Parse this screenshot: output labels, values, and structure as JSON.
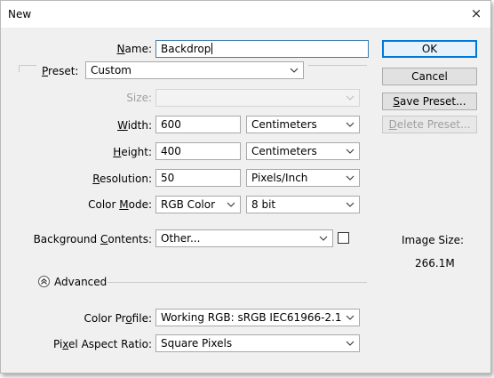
{
  "window": {
    "title": "New",
    "close_glyph": "×"
  },
  "fields": {
    "name": {
      "label_pre": "",
      "label_key": "N",
      "label_post": "ame:",
      "value": "Backdrop"
    },
    "preset": {
      "label_key": "P",
      "label_post": "reset:",
      "value": "Custom"
    },
    "size": {
      "label": "Size:",
      "value": ""
    },
    "width": {
      "label_key": "W",
      "label_post": "idth:",
      "value": "600",
      "unit": "Centimeters"
    },
    "height": {
      "label_key": "H",
      "label_post": "eight:",
      "value": "400",
      "unit": "Centimeters"
    },
    "resolution": {
      "label_key": "R",
      "label_post": "esolution:",
      "value": "50",
      "unit": "Pixels/Inch"
    },
    "color_mode": {
      "label_pre": "Color ",
      "label_key": "M",
      "label_post": "ode:",
      "value": "RGB Color",
      "bit_depth": "8 bit"
    },
    "background": {
      "label_pre": "Background ",
      "label_key": "C",
      "label_post": "ontents:",
      "value": "Other..."
    },
    "advanced": {
      "label": "Advanced"
    },
    "color_profile": {
      "label_pre": "Color Pr",
      "label_key": "o",
      "label_post": "file:",
      "value": "Working RGB:  sRGB IEC61966-2.1"
    },
    "pixel_aspect": {
      "label_pre": "Pi",
      "label_key": "x",
      "label_post": "el Aspect Ratio:",
      "value": "Square Pixels"
    }
  },
  "buttons": {
    "ok": "OK",
    "cancel": "Cancel",
    "save_preset_key": "S",
    "save_preset_rest": "ave Preset...",
    "delete_preset_key": "D",
    "delete_preset_rest": "elete Preset..."
  },
  "image_size": {
    "label": "Image Size:",
    "value": "266.1M"
  },
  "colors": {
    "focus_border": "#3c7fb1",
    "default_button": "#0078d7",
    "dialog_bg": "#f0f0f0"
  },
  "icons": {
    "dropdown": "chevron-down-icon",
    "advanced": "double-chevron-up-icon",
    "close": "close-icon"
  }
}
